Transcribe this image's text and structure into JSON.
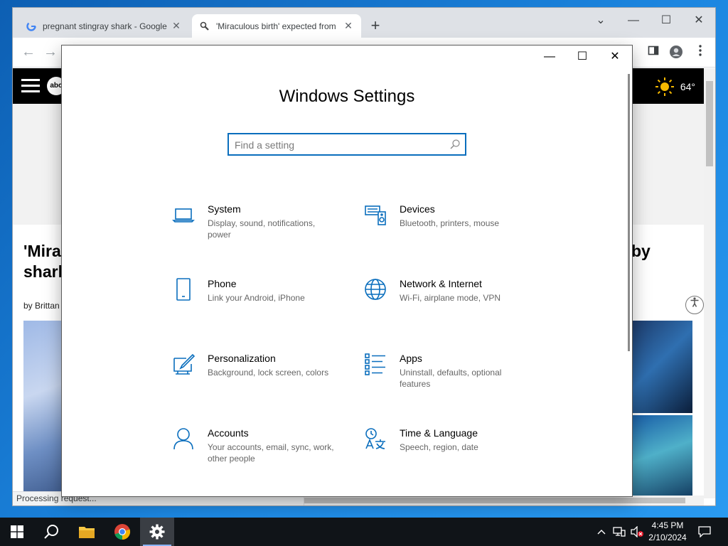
{
  "browser": {
    "tabs": [
      {
        "title": "pregnant stingray shark - Google",
        "favicon": "google-g-icon"
      },
      {
        "title": "'Miraculous birth' expected from",
        "favicon": "abc-news-icon"
      }
    ],
    "close_glyph": "✕",
    "new_tab_glyph": "+",
    "window_controls": {
      "tablist": "⌄",
      "minimize": "—",
      "maximize": "☐",
      "close": "✕"
    },
    "nav": {
      "back": "←",
      "forward": "→"
    }
  },
  "page": {
    "logo_text": "abc",
    "weather_temp": "64°",
    "headline_left_1": "'Mira",
    "headline_left_2": "shark",
    "headline_right": "by",
    "byline": "by Brittan",
    "status_text": "Processing request..."
  },
  "settings": {
    "title": "Windows Settings",
    "search_placeholder": "Find a setting",
    "controls": {
      "minimize": "—",
      "maximize": "☐",
      "close": "✕"
    },
    "categories": [
      {
        "name": "System",
        "description": "Display, sound, notifications, power",
        "icon": "laptop-icon"
      },
      {
        "name": "Devices",
        "description": "Bluetooth, printers, mouse",
        "icon": "keyboard-speaker-icon"
      },
      {
        "name": "Phone",
        "description": "Link your Android, iPhone",
        "icon": "phone-icon"
      },
      {
        "name": "Network & Internet",
        "description": "Wi-Fi, airplane mode, VPN",
        "icon": "globe-icon"
      },
      {
        "name": "Personalization",
        "description": "Background, lock screen, colors",
        "icon": "paint-brush-icon"
      },
      {
        "name": "Apps",
        "description": "Uninstall, defaults, optional features",
        "icon": "apps-list-icon"
      },
      {
        "name": "Accounts",
        "description": "Your accounts, email, sync, work, other people",
        "icon": "person-icon"
      },
      {
        "name": "Time & Language",
        "description": "Speech, region, date",
        "icon": "time-language-icon"
      }
    ]
  },
  "taskbar": {
    "apps": [
      "start-icon",
      "search-icon",
      "file-explorer-icon",
      "chrome-icon",
      "settings-gear-icon"
    ],
    "clock_time": "4:45 PM",
    "clock_date": "2/10/2024"
  },
  "colors": {
    "accent": "#0a6ebd",
    "taskbar": "#101418",
    "chrome_tabstrip": "#dee1e6"
  }
}
